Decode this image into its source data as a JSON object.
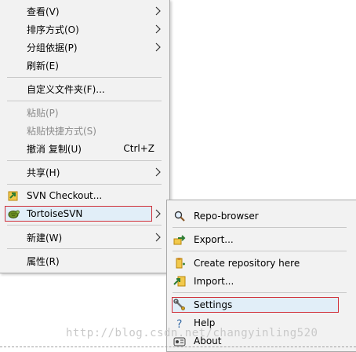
{
  "main_menu": {
    "view": "查看(V)",
    "sort_by": "排序方式(O)",
    "group_by": "分组依据(P)",
    "refresh": "刷新(E)",
    "customize_folder": "自定义文件夹(F)...",
    "paste": "粘贴(P)",
    "paste_shortcut": "粘贴快捷方式(S)",
    "undo_copy": "撤消 复制(U)",
    "undo_shortcut": "Ctrl+Z",
    "share": "共享(H)",
    "svn_checkout": "SVN Checkout...",
    "tortoise_svn": "TortoiseSVN",
    "new": "新建(W)",
    "properties": "属性(R)"
  },
  "sub_menu": {
    "repo_browser": "Repo-browser",
    "export": "Export...",
    "create_repo": "Create repository here",
    "import": "Import...",
    "settings": "Settings",
    "help": "Help",
    "about": "About"
  },
  "watermark": "http://blog.csdn.net/changyinling520"
}
